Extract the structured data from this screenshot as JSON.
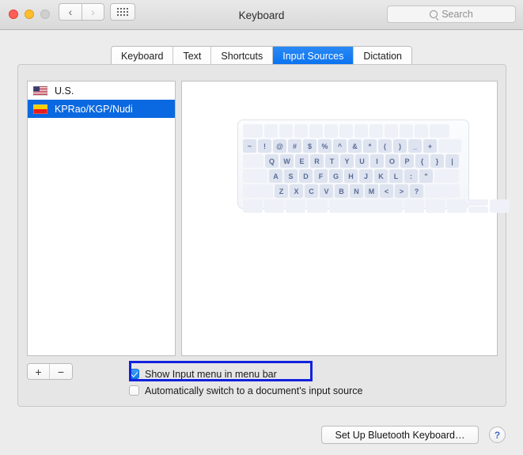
{
  "window": {
    "title": "Keyboard",
    "traffic_lights": [
      "close",
      "minimize",
      "zoom"
    ],
    "nav_back": "‹",
    "nav_forward": "›",
    "grid_button": "show-all-grid"
  },
  "search": {
    "placeholder": "Search",
    "value": "",
    "icon": "search-icon"
  },
  "tabs": [
    {
      "label": "Keyboard",
      "active": false
    },
    {
      "label": "Text",
      "active": false
    },
    {
      "label": "Shortcuts",
      "active": false
    },
    {
      "label": "Input Sources",
      "active": true
    },
    {
      "label": "Dictation",
      "active": false
    }
  ],
  "input_sources": [
    {
      "label": "U.S.",
      "flag": "us-flag-icon",
      "selected": false
    },
    {
      "label": "KPRao/KGP/Nudi",
      "flag": "kannada-flag-icon",
      "selected": true
    }
  ],
  "list_buttons": {
    "add": "+",
    "remove": "−"
  },
  "keyboard_preview": {
    "rows": [
      [
        "",
        "",
        "",
        "",
        "",
        "",
        "",
        "",
        "",
        "",
        "",
        "",
        "",
        ""
      ],
      [
        "~",
        "!",
        "@",
        "#",
        "$",
        "%",
        "^",
        "&",
        "*",
        "(",
        ")",
        "_",
        "+",
        ""
      ],
      [
        "",
        "Q",
        "W",
        "E",
        "R",
        "T",
        "Y",
        "U",
        "I",
        "O",
        "P",
        "{",
        "}",
        "|"
      ],
      [
        "",
        "A",
        "S",
        "D",
        "F",
        "G",
        "H",
        "J",
        "K",
        "L",
        ":",
        "\"",
        ""
      ],
      [
        "",
        "Z",
        "X",
        "C",
        "V",
        "B",
        "N",
        "M",
        "<",
        ">",
        "?",
        ""
      ],
      [
        "",
        "",
        "",
        "",
        "",
        "",
        "",
        "",
        ""
      ]
    ]
  },
  "checkboxes": [
    {
      "label": "Show Input menu in menu bar",
      "checked": true,
      "highlighted": true
    },
    {
      "label": "Automatically switch to a document's input source",
      "checked": false,
      "highlighted": false
    }
  ],
  "footer": {
    "bluetooth_button": "Set Up Bluetooth Keyboard…",
    "help_button": "?"
  },
  "colors": {
    "accent_blue": "#0a72ef",
    "selection_blue": "#0a68e0",
    "annotation_blue": "#1122dd",
    "window_bg": "#ececec",
    "panel_bg": "#e6e6e6"
  }
}
